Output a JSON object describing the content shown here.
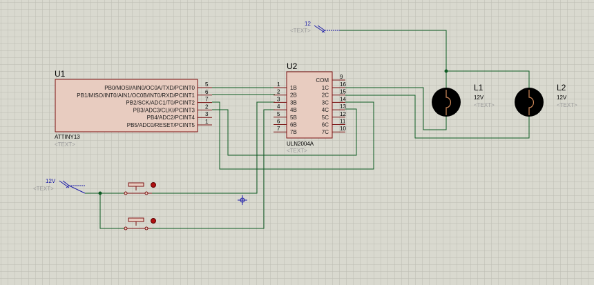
{
  "u1": {
    "ref": "U1",
    "part": "ATTINY13",
    "text": "<TEXT>",
    "pins": [
      {
        "name": "PB0/MOSI/AIN0/OC0A/TXD/PCINT0",
        "num": "5"
      },
      {
        "name": "PB1/MISO/INT0/AIN1/OC0B/INT0/RXD/PCINT1",
        "num": "6"
      },
      {
        "name": "PB2/SCK/ADC1/T0/PCINT2",
        "num": "7"
      },
      {
        "name": "PB3/ADC3/CLKI/PCINT3",
        "num": "2"
      },
      {
        "name": "PB4/ADC2/PCINT4",
        "num": "3"
      },
      {
        "name": "PB5/ADC0/RESET/PCINT5",
        "num": "1"
      }
    ]
  },
  "u2": {
    "ref": "U2",
    "part": "ULN2004A",
    "text": "<TEXT>",
    "com": "COM",
    "com_pin": "9",
    "left_pins": [
      {
        "name": "1B",
        "num": "1"
      },
      {
        "name": "2B",
        "num": "2"
      },
      {
        "name": "3B",
        "num": "3"
      },
      {
        "name": "4B",
        "num": "4"
      },
      {
        "name": "5B",
        "num": "5"
      },
      {
        "name": "6B",
        "num": "6"
      },
      {
        "name": "7B",
        "num": "7"
      }
    ],
    "right_pins": [
      {
        "name": "1C",
        "num": "16"
      },
      {
        "name": "2C",
        "num": "15"
      },
      {
        "name": "3C",
        "num": "14"
      },
      {
        "name": "4C",
        "num": "13"
      },
      {
        "name": "5C",
        "num": "12"
      },
      {
        "name": "6C",
        "num": "11"
      },
      {
        "name": "7C",
        "num": "10"
      }
    ]
  },
  "l1": {
    "ref": "L1",
    "value": "12V",
    "text": "<TEXT>"
  },
  "l2": {
    "ref": "L2",
    "value": "12V",
    "text": "<TEXT>"
  },
  "power_top": {
    "label": "12",
    "text": "<TEXT>"
  },
  "power_left": {
    "label": "12V",
    "text": "<TEXT>"
  },
  "colors": {
    "background": "#d9d9cf",
    "grid": "#bcbcb2",
    "wire": "#0c5a22",
    "component_body": "#e8ccc0",
    "component_border": "#7a1010",
    "terminal_label": "#1a1aa8",
    "placeholder_text": "#9a9a9a"
  }
}
